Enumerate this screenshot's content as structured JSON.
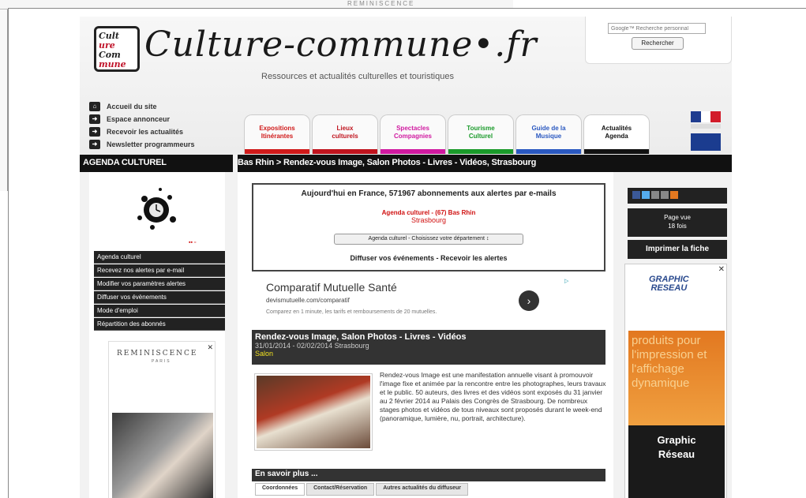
{
  "background": {
    "top_text": "",
    "reminiscence": "REMINISCENCE"
  },
  "header": {
    "logo_badge": [
      "Cult",
      "ure",
      "Com",
      "mune"
    ],
    "site_title": "Culture-commune•.fr",
    "tagline": "Ressources et actualités culturelles et touristiques",
    "search_placeholder": "Google™ Recherche personnal",
    "search_button": "Rechercher"
  },
  "quick_links": [
    {
      "label": "Accueil du site",
      "icon": "home-icon"
    },
    {
      "label": "Espace annonceur",
      "icon": "arrow-icon"
    },
    {
      "label": "Recevoir les actualités",
      "icon": "arrow-icon"
    },
    {
      "label": "Newsletter programmeurs",
      "icon": "arrow-icon"
    }
  ],
  "tabs": [
    {
      "line1": "Expositions",
      "line2": "Itinérantes",
      "color": "#d01a1a"
    },
    {
      "line1": "Lieux",
      "line2": "culturels",
      "color": "#c0141e"
    },
    {
      "line1": "Spectacles",
      "line2": "Compagnies",
      "color": "#d01aa0"
    },
    {
      "line1": "Tourisme",
      "line2": "Culturel",
      "color": "#1a9a2a"
    },
    {
      "line1": "Guide de la",
      "line2": "Musique",
      "color": "#2a58c0"
    },
    {
      "line1": "Actualités",
      "line2": "Agenda",
      "color": "#111111"
    }
  ],
  "bar": {
    "left": "AGENDA CULTUREL",
    "breadcrumb": "Bas Rhin > Rendez-vous Image, Salon Photos - Livres - Vidéos, Strasbourg"
  },
  "left_menu": [
    "Agenda culturel",
    "Recevez nos alertes par e-mail",
    "Modifier vos paramètres alertes",
    "Diffuser vos évènements",
    "Mode d'emploi",
    "Répartition des abonnés"
  ],
  "left_ad": {
    "brand": "REMINISCENCE",
    "city": "PARIS",
    "close": "✕"
  },
  "alert_box": {
    "title": "Aujourd'hui en France, 571967 abonnements aux alertes par e-mails",
    "agenda": "Agenda culturel - (67) Bas Rhin",
    "city": "Strasbourg",
    "select_value": "Agenda culturel - Choisissez votre département ↕",
    "actions": "Diffuser vos événements - Recevoir les alertes"
  },
  "ad_mutuelle": {
    "title": "Comparatif Mutuelle Santé",
    "url": "devismutuelle.com/comparatif",
    "desc": "Comparez en 1 minute, les tarifs et remboursements de 20 mutuelles.",
    "arrow": "›",
    "badge": "▷"
  },
  "event": {
    "title": "Rendez-vous Image, Salon Photos - Livres - Vidéos",
    "date": "31/01/2014 - 02/02/2014 Strasbourg",
    "type": "Salon",
    "description": "Rendez-vous Image est une manifestation annuelle visant à promouvoir l'image fixe et animée par la rencontre entre les photographes, leurs travaux et le public. 50 auteurs, des livres et des vidéos sont exposés du 31 janvier au 2 février 2014 au Palais des Congrès de Strasbourg. De nombreux stages photos et vidéos de tous niveaux sont proposés durant le week-end (panoramique, lumière, nu, portrait, architecture)."
  },
  "more": {
    "title": "En savoir plus ...",
    "tabs": [
      "Coordonnées",
      "Contact/Réservation",
      "Autres actualités du diffuseur"
    ]
  },
  "right": {
    "page_view_label": "Page vue",
    "page_view_count": "18 fois",
    "print": "Imprimer la fiche",
    "ad_logo_1": "GRAPHIC",
    "ad_logo_2": "RESEAU",
    "ad_slogan": "produits pour l'impression et l'affichage dynamique",
    "ad_brand_1": "Graphic",
    "ad_brand_2": "Réseau",
    "close": "✕"
  },
  "colors": {
    "social_fb": "#3b5998",
    "social_tw": "#55acee",
    "social_mail": "#888888",
    "social_plus": "#e27820"
  }
}
